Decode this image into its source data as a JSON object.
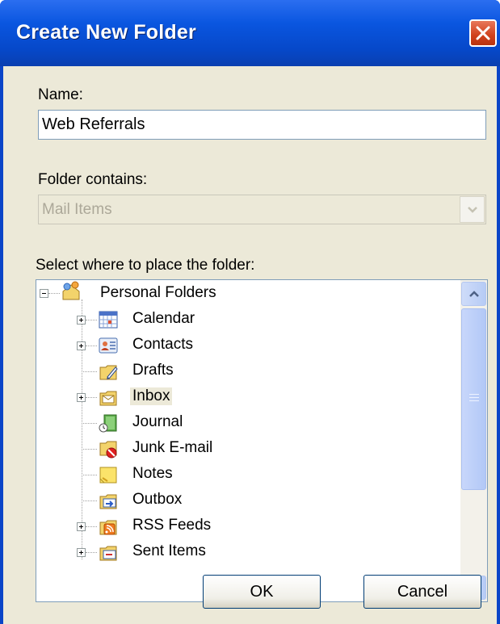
{
  "window": {
    "title": "Create New Folder"
  },
  "name_field": {
    "label": "Name:",
    "value": "Web Referrals"
  },
  "contains_field": {
    "label": "Folder contains:",
    "value": "Mail Items"
  },
  "location": {
    "label": "Select where to place the folder:",
    "root": {
      "label": "Personal Folders",
      "icon": "personal-folders-icon"
    },
    "items": [
      {
        "label": "Calendar",
        "icon": "calendar-icon",
        "expandable": true
      },
      {
        "label": "Contacts",
        "icon": "contacts-icon",
        "expandable": true
      },
      {
        "label": "Drafts",
        "icon": "drafts-icon",
        "expandable": false
      },
      {
        "label": "Inbox",
        "icon": "inbox-icon",
        "expandable": true,
        "selected": true
      },
      {
        "label": "Journal",
        "icon": "journal-icon",
        "expandable": false
      },
      {
        "label": "Junk E-mail",
        "icon": "junk-email-icon",
        "expandable": false
      },
      {
        "label": "Notes",
        "icon": "notes-icon",
        "expandable": false
      },
      {
        "label": "Outbox",
        "icon": "outbox-icon",
        "expandable": false
      },
      {
        "label": "RSS Feeds",
        "icon": "rss-feeds-icon",
        "expandable": true
      },
      {
        "label": "Sent Items",
        "icon": "sent-items-icon",
        "expandable": true
      }
    ]
  },
  "buttons": {
    "ok": "OK",
    "cancel": "Cancel"
  }
}
